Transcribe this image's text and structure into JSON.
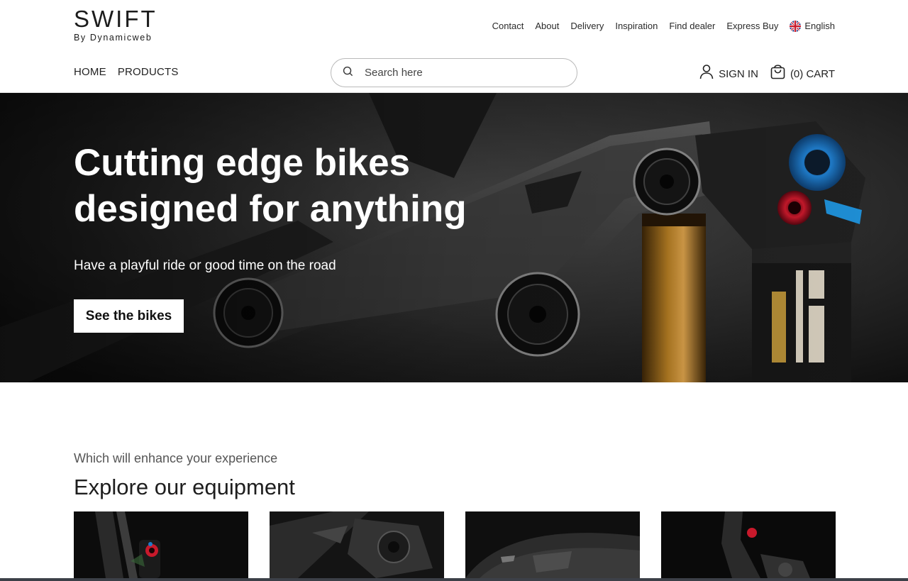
{
  "brand": {
    "name": "SWIFT",
    "tagline": "By Dynamicweb"
  },
  "utility_nav": {
    "links": [
      "Contact",
      "About",
      "Delivery",
      "Inspiration",
      "Find dealer",
      "Express Buy"
    ],
    "language": {
      "label": "English",
      "icon": "uk-flag-icon"
    }
  },
  "main_nav": {
    "items": [
      "HOME",
      "PRODUCTS"
    ]
  },
  "search": {
    "placeholder": "Search here",
    "icon": "search-icon"
  },
  "account": {
    "sign_in": {
      "label": "SIGN IN",
      "icon": "user-icon"
    },
    "cart": {
      "label": "(0) CART",
      "icon": "shopping-bag-icon"
    }
  },
  "hero": {
    "title": "Cutting edge bikes\ndesigned for anything",
    "subtitle": "Have a playful ride or good time on the road",
    "cta_label": "See the bikes"
  },
  "equipment": {
    "kicker": "Which will enhance your experience",
    "title": "Explore our equipment",
    "cards": [
      {
        "name": "equipment-card-1"
      },
      {
        "name": "equipment-card-2"
      },
      {
        "name": "equipment-card-3"
      },
      {
        "name": "equipment-card-4"
      }
    ]
  },
  "colors": {
    "text": "#222222",
    "hero_bg": "#1b1b1b",
    "shock_blue": "#1f7bc9",
    "accent_red": "#c8192b",
    "gold": "#a8741f"
  }
}
